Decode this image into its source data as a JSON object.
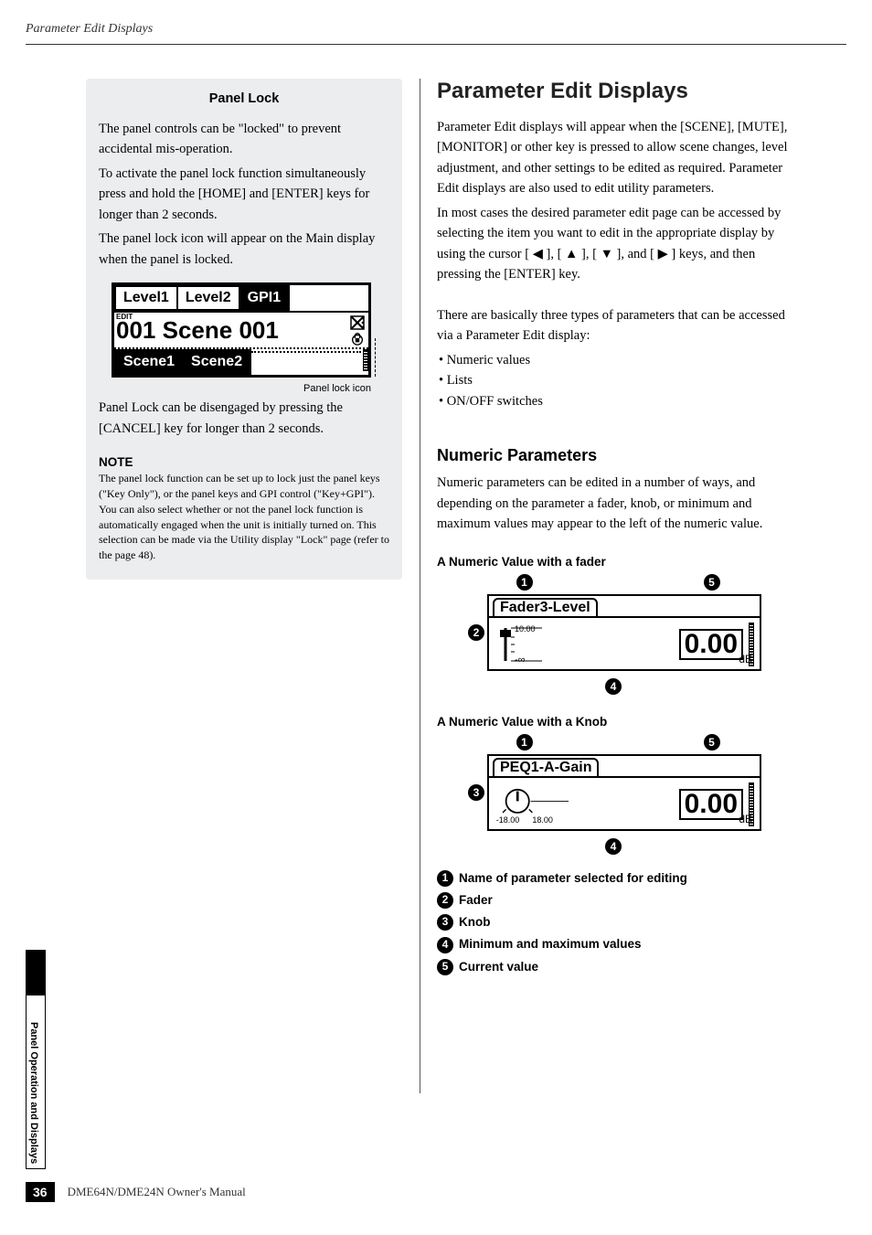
{
  "header": {
    "title": "Parameter Edit Displays"
  },
  "panel_lock": {
    "heading": "Panel Lock",
    "p1": "The panel controls can be \"locked\" to prevent accidental mis-operation.",
    "p2": "To activate the panel lock function simultaneously press and hold the [HOME] and [ENTER] keys for longer than 2 seconds.",
    "p3": "The panel lock icon will appear on the Main display when the panel is locked.",
    "lcd": {
      "tab1": "Level1",
      "tab2": "Level2",
      "tab3": "GPI1",
      "edit": "EDIT",
      "scene_num": "001",
      "scene_name": "Scene 001",
      "btab1": "Scene1",
      "btab2": "Scene2"
    },
    "caption": "Panel lock icon",
    "p4": "Panel Lock can be disengaged by pressing the [CANCEL] key for longer than 2 seconds.",
    "note_h": "NOTE",
    "note_body": "The panel lock function can be set up to lock just the panel keys (\"Key Only\"), or the panel keys and GPI control (\"Key+GPI\"). You can also select whether or not the panel lock function is automatically engaged when the unit is initially turned on. This selection can be made via the Utility display \"Lock\" page (refer to the page 48)."
  },
  "ped": {
    "title": "Parameter Edit Displays",
    "intro1": "Parameter Edit displays will appear when the [SCENE], [MUTE], [MONITOR] or other key is pressed to allow scene changes, level adjustment, and other settings to be edited as required. Parameter Edit displays are also used to edit utility parameters.",
    "intro2a": "In most cases the desired parameter edit page can be accessed by selecting the item you want to edit in the appropriate display by using the cursor [ ",
    "intro2b": " ], [ ",
    "intro2c": " ], [ ",
    "intro2d": " ], and [ ",
    "intro2e": " ] keys, and then pressing the [ENTER] key.",
    "types_intro": "There are basically three types of parameters that can be accessed via a Parameter Edit display:",
    "types": [
      "Numeric values",
      "Lists",
      "ON/OFF switches"
    ],
    "numeric": {
      "h": "Numeric Parameters",
      "body": "Numeric parameters can be edited in a number of ways, and depending on the parameter a fader, knob, or minimum and maximum values may appear to the left of the numeric value.",
      "fader_h": "A Numeric Value with a fader",
      "knob_h": "A Numeric Value with a Knob",
      "fader": {
        "title": "Fader3-Level",
        "max": "10.00",
        "min": "-∞",
        "value": "0.00",
        "unit": "dB"
      },
      "knob": {
        "title": "PEQ1-A-Gain",
        "min": "-18.00",
        "max": "18.00",
        "value": "0.00",
        "unit": "dB"
      }
    },
    "defs": {
      "d1": "Name of parameter selected for editing",
      "d2": "Fader",
      "d3": "Knob",
      "d4": "Minimum and maximum values",
      "d5": "Current value"
    }
  },
  "side_tab": "Panel Operation and Displays",
  "footer": {
    "page": "36",
    "book": "DME64N/DME24N Owner's Manual"
  }
}
